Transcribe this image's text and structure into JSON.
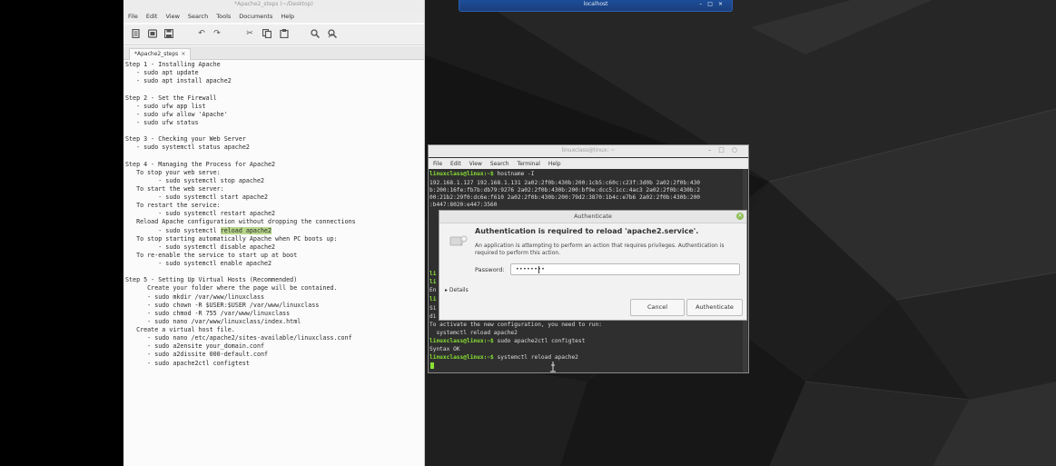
{
  "top_window": {
    "title": "localhost"
  },
  "editor": {
    "title": "*Apache2_steps (~/Desktop)",
    "menu": [
      "File",
      "Edit",
      "View",
      "Search",
      "Tools",
      "Documents",
      "Help"
    ],
    "toolbar_icons": [
      "new-file-icon",
      "open-icon",
      "save-icon",
      "undo-icon",
      "redo-icon",
      "cut-icon",
      "copy-icon",
      "paste-icon",
      "find-icon",
      "replace-icon"
    ],
    "tab_label": "*Apache2_steps",
    "tab_close": "×",
    "lines": [
      "Step 1 - Installing Apache",
      "   - sudo apt update",
      "   - sudo apt install apache2",
      "",
      "Step 2 - Set the Firewall",
      "   - sudo ufw app list",
      "   - sudo ufw allow 'Apache'",
      "   - sudo ufw status",
      "",
      "Step 3 - Checking your Web Server",
      "   - sudo systemctl status apache2",
      "",
      "Step 4 - Managing the Process for Apache2",
      "   To stop your web serve:",
      "         - sudo systemctl stop apache2",
      "   To start the web server:",
      "         - sudo systemctl start apache2",
      "   To restart the service:",
      "         - sudo systemctl restart apache2",
      "   Reload Apache configuration without dropping the connections",
      "",
      "   To stop starting automatically Apache when PC boots up:",
      "         - sudo systemctl disable apache2",
      "   To re-enable the service to start up at boot",
      "         - sudo systemctl enable apache2",
      "",
      "Step 5 - Setting Up Virtual Hosts (Recommended)",
      "      Create your folder where the page will be contained.",
      "      - sudo mkdir /var/www/linuxclass",
      "      - sudo chown -R $USER:$USER /var/www/linuxclass",
      "      - sudo chmod -R 755 /var/www/linuxclass",
      "      - sudo nano /var/www/linuxclass/index.html",
      "   Create a virtual host file.",
      "      - sudo nano /etc/apache2/sites-available/linuxclass.conf",
      "      - sudo a2ensite your_domain.conf",
      "      - sudo a2dissite 000-default.conf",
      "      - sudo apache2ctl configtest"
    ],
    "highlight_line_prefix": "         - sudo systemctl ",
    "highlight_text": "reload apache2"
  },
  "terminal": {
    "title": "linuxclass@linux: ~",
    "menu": [
      "File",
      "Edit",
      "View",
      "Search",
      "Terminal",
      "Help"
    ],
    "prompt": "linuxclass@linux:~$",
    "cmd1": " hostname -I",
    "output_lines": [
      "192.168.1.127 192.168.1.131 2a02:2f0b:430b:200:1cb5:c60c:c23f:3d0b 2a02:2f0b:430",
      "b:200:16fe:fb7b:db79:9276 2a02:2f0b:430b:200:bf9e:dcc5:1cc:4ac3 2a02:2f0b:430b:2",
      "00:21b2:29f0:dc6e:f610 2a02:2f0b:430b:200:79d2:3870:1b4c:e7b6 2a02:2f0b:430b:200",
      ":b447:8020:e447:3560"
    ],
    "lower_lines": [
      "To activate the new configuration, you need to run:",
      "  systemctl reload apache2"
    ],
    "cmd2": " sudo apache2ctl configtest",
    "syntax_ok": "Syntax OK",
    "cmd3": " systemctl reload apache2",
    "left_fragments": [
      "li",
      "li",
      "En",
      "li",
      "Si",
      "di",
      "li",
      "li",
      "li"
    ]
  },
  "auth": {
    "window_title": "Authenticate",
    "heading": "Authentication is required to reload 'apache2.service'.",
    "description": "An application is attempting to perform an action that requires privileges. Authentication is required to perform this action.",
    "password_label": "Password:",
    "password_value": "••••••••",
    "details_label": "▸ Details",
    "cancel_label": "Cancel",
    "authenticate_label": "Authenticate"
  }
}
